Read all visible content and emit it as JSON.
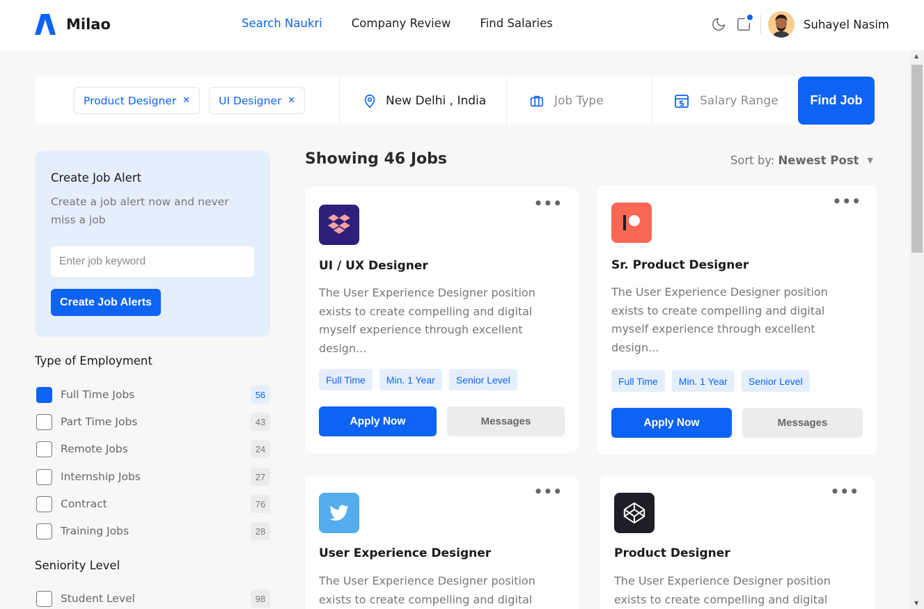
{
  "header": {
    "app_name": "Milao",
    "nav": [
      {
        "label": "Search Naukri",
        "active": true
      },
      {
        "label": "Company Review",
        "active": false
      },
      {
        "label": "Find Salaries",
        "active": false
      }
    ],
    "user_name": "Suhayel Nasim",
    "icons": [
      "moon-icon",
      "notification-icon"
    ]
  },
  "search": {
    "tags": [
      "Product Designer",
      "UI Designer"
    ],
    "location": "New Delhi , India",
    "job_type_placeholder": "Job Type",
    "salary_placeholder": "Salary Range",
    "find_label": "Find Job"
  },
  "alert": {
    "title": "Create Job Alert",
    "subtitle": "Create a job alert now and never miss a job",
    "input_placeholder": "Enter job keyword",
    "button_label": "Create Job Alerts"
  },
  "employment": {
    "title": "Type of Employment",
    "items": [
      {
        "label": "Full Time Jobs",
        "count": "56",
        "checked": true
      },
      {
        "label": "Part Time Jobs",
        "count": "43",
        "checked": false
      },
      {
        "label": "Remote Jobs",
        "count": "24",
        "checked": false
      },
      {
        "label": "Internship Jobs",
        "count": "27",
        "checked": false
      },
      {
        "label": "Contract",
        "count": "76",
        "checked": false
      },
      {
        "label": "Training Jobs",
        "count": "28",
        "checked": false
      }
    ]
  },
  "seniority": {
    "title": "Seniority Level",
    "items": [
      {
        "label": "Student Level",
        "count": "98",
        "checked": false
      }
    ]
  },
  "results": {
    "showing": "Showing 46 Jobs",
    "sort_prefix": "Sort by:",
    "sort_value": "Newest Post"
  },
  "jobs": [
    {
      "title": "UI / UX Designer",
      "company_icon": "dropbox-icon",
      "logo_color": "#2e1f7a",
      "description": "The User Experience Designer position exists to create compelling and digital myself experience through excellent design...",
      "chips": [
        "Full Time",
        "Min. 1 Year",
        "Senior Level"
      ],
      "apply_label": "Apply Now",
      "message_label": "Messages"
    },
    {
      "title": "Sr. Product Designer",
      "company_icon": "patreon-icon",
      "logo_color": "#f96854",
      "description": "The User Experience Designer position exists to create compelling and digital myself experience through excellent design...",
      "chips": [
        "Full Time",
        "Min. 1 Year",
        "Senior Level"
      ],
      "apply_label": "Apply Now",
      "message_label": "Messages"
    },
    {
      "title": "User Experience Designer",
      "company_icon": "twitter-icon",
      "logo_color": "#55acee",
      "description": "The User Experience Designer position exists to create compelling and digital",
      "chips": [],
      "apply_label": "",
      "message_label": ""
    },
    {
      "title": "Product Designer",
      "company_icon": "codepen-icon",
      "logo_color": "#1e1f26",
      "description": "The User Experience Designer position exists to create compelling and digital",
      "chips": [],
      "apply_label": "",
      "message_label": ""
    }
  ],
  "colors": {
    "accent": "#0d63f3",
    "alert_bg": "#e5effc",
    "page_bg": "#f7f7f7"
  }
}
